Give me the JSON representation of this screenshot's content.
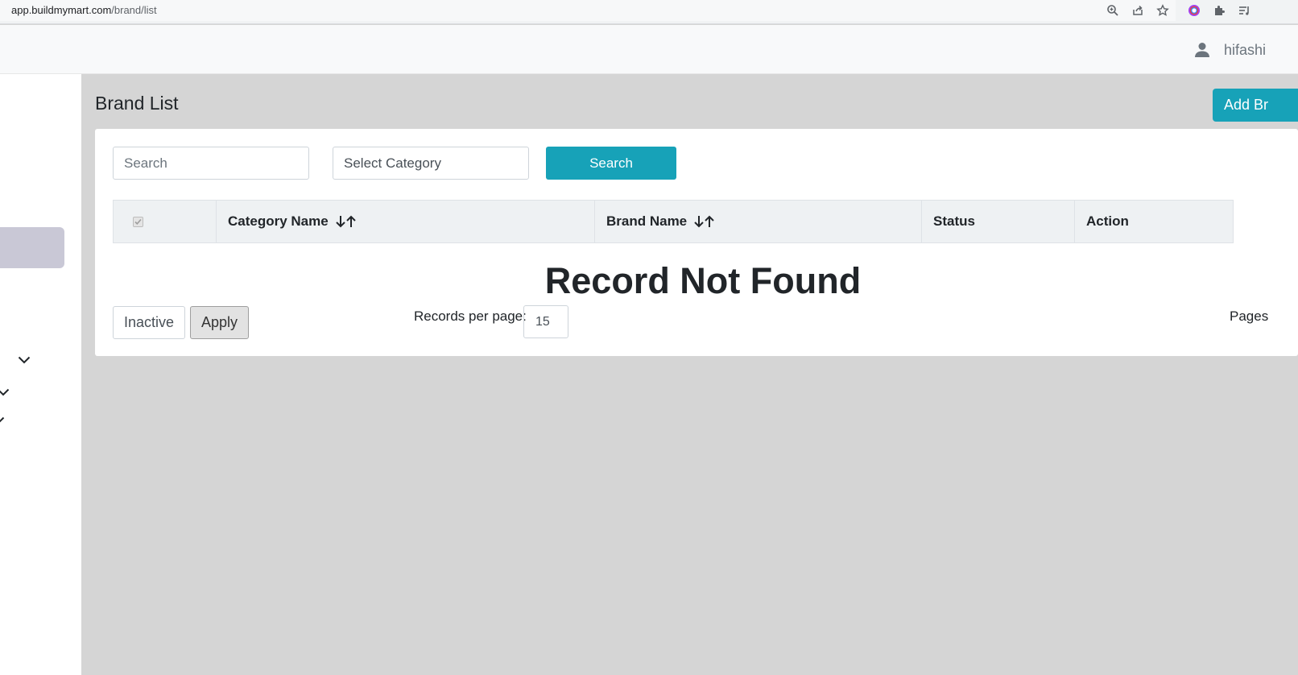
{
  "browser": {
    "url_host": "app.buildmymart.com",
    "url_path": "/brand/list"
  },
  "header": {
    "user_name": "hifashi"
  },
  "page": {
    "title": "Brand List",
    "add_button_label": "Add Br"
  },
  "filters": {
    "search_placeholder": "Search",
    "category_select_value": "Select Category",
    "search_button_label": "Search"
  },
  "table": {
    "columns": [
      "Category Name",
      "Brand Name",
      "Status",
      "Action"
    ],
    "empty_message": "Record Not Found"
  },
  "footer": {
    "inactive_label": "Inactive",
    "apply_label": "Apply",
    "records_per_page_label": "Records per page:",
    "records_per_page_value": "15",
    "pages_label": "Pages"
  },
  "colors": {
    "accent": "#17a2b8",
    "sidebar_active": "#c9c8d6",
    "content_bg": "#d5d5d5"
  }
}
